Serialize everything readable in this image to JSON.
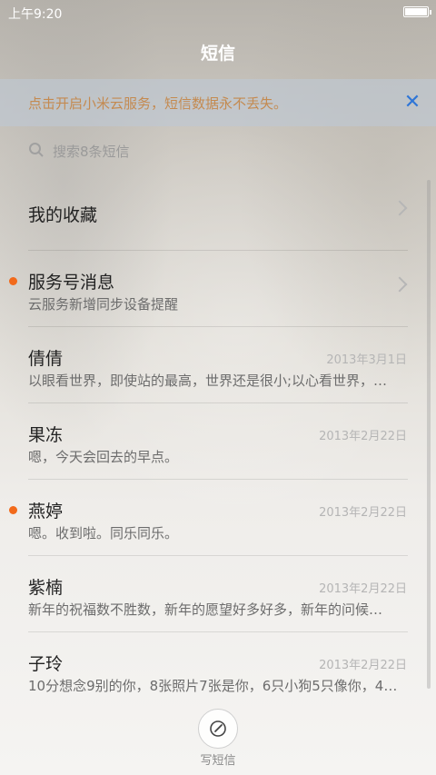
{
  "status": {
    "time": "上午9:20"
  },
  "header": {
    "title": "短信"
  },
  "banner": {
    "text": "点击开启小米云服务，短信数据永不丢失。"
  },
  "search": {
    "placeholder": "搜索8条短信"
  },
  "list": [
    {
      "name": "我的收藏",
      "preview": "",
      "date": "",
      "unread": false,
      "chevron": true
    },
    {
      "name": "服务号消息",
      "preview": "云服务新增同步设备提醒",
      "date": "",
      "unread": true,
      "chevron": true
    },
    {
      "name": "倩倩",
      "preview": "以眼看世界，即使站的最高，世界还是很小;以心看世界，…",
      "date": "2013年3月1日",
      "unread": false,
      "chevron": false
    },
    {
      "name": "果冻",
      "preview": "嗯，今天会回去的早点。",
      "date": "2013年2月22日",
      "unread": false,
      "chevron": false
    },
    {
      "name": "燕婷",
      "preview": "嗯。收到啦。同乐同乐。",
      "date": "2013年2月22日",
      "unread": true,
      "chevron": false
    },
    {
      "name": "紫楠",
      "preview": "新年的祝福数不胜数，新年的愿望好多好多，新年的问候…",
      "date": "2013年2月22日",
      "unread": false,
      "chevron": false
    },
    {
      "name": "子玲",
      "preview": "10分想念9别的你，8张照片7张是你，6只小狗5只像你，4…",
      "date": "2013年2月22日",
      "unread": false,
      "chevron": false
    }
  ],
  "compose": {
    "label": "写短信"
  },
  "colors": {
    "accent": "#2f76d7",
    "unread_dot": "#f26a1b",
    "banner_text": "#c48a50"
  }
}
